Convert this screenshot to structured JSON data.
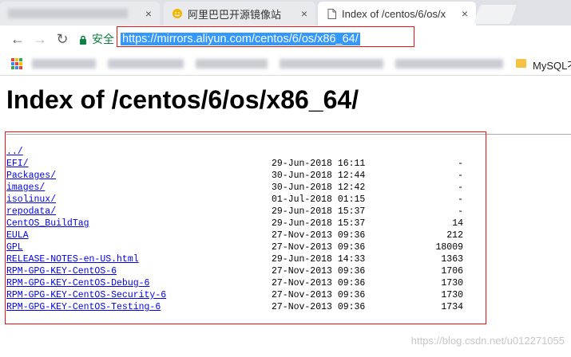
{
  "browser": {
    "tabs": [
      {
        "title": "",
        "blurred": true,
        "close": "×"
      },
      {
        "title": "阿里巴巴开源镜像站",
        "close": "×",
        "icon": "aliyun-smiley-icon"
      },
      {
        "title": "Index of /centos/6/os/x",
        "close": "×",
        "icon": "page-icon",
        "active": true
      }
    ],
    "toolbar": {
      "back": "←",
      "forward": "→",
      "reload": "↻",
      "secure_label": "安全",
      "url": "https://mirrors.aliyun.com/centos/6/os/x86_64/"
    },
    "bookmarks": {
      "apps_colors": [
        "#ea4335",
        "#fbbc05",
        "#34a853",
        "#4285f4",
        "#ea4335",
        "#fbbc05",
        "#34a853",
        "#4285f4",
        "#ea4335"
      ],
      "visible_label": "MySQL不"
    }
  },
  "page": {
    "title": "Index of /centos/6/os/x86_64/",
    "entries": [
      {
        "name": "../",
        "date": "",
        "size": ""
      },
      {
        "name": "EFI/",
        "date": "29-Jun-2018 16:11",
        "size": "-"
      },
      {
        "name": "Packages/",
        "date": "30-Jun-2018 12:44",
        "size": "-"
      },
      {
        "name": "images/",
        "date": "30-Jun-2018 12:42",
        "size": "-"
      },
      {
        "name": "isolinux/",
        "date": "01-Jul-2018 01:15",
        "size": "-"
      },
      {
        "name": "repodata/",
        "date": "29-Jun-2018 15:37",
        "size": "-"
      },
      {
        "name": "CentOS_BuildTag",
        "date": "29-Jun-2018 15:37",
        "size": "14"
      },
      {
        "name": "EULA",
        "date": "27-Nov-2013 09:36",
        "size": "212"
      },
      {
        "name": "GPL",
        "date": "27-Nov-2013 09:36",
        "size": "18009"
      },
      {
        "name": "RELEASE-NOTES-en-US.html",
        "date": "29-Jun-2018 14:33",
        "size": "1363"
      },
      {
        "name": "RPM-GPG-KEY-CentOS-6",
        "date": "27-Nov-2013 09:36",
        "size": "1706"
      },
      {
        "name": "RPM-GPG-KEY-CentOS-Debug-6",
        "date": "27-Nov-2013 09:36",
        "size": "1730"
      },
      {
        "name": "RPM-GPG-KEY-CentOS-Security-6",
        "date": "27-Nov-2013 09:36",
        "size": "1730"
      },
      {
        "name": "RPM-GPG-KEY-CentOS-Testing-6",
        "date": "27-Nov-2013 09:36",
        "size": "1734"
      }
    ]
  },
  "watermark": "https://blog.csdn.net/u012271055",
  "colors": {
    "link": "#0000ee",
    "annotation_red": "#ee1111",
    "url_selection": "#3399ff",
    "secure_green": "#0b8043"
  }
}
